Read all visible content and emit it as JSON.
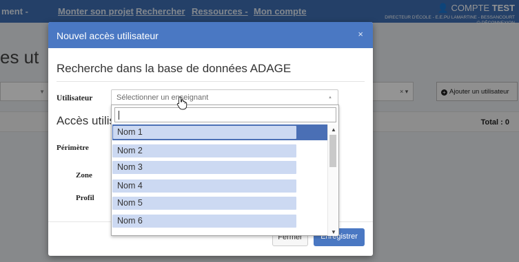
{
  "background": {
    "nav": {
      "items": [
        "ment -",
        "Monter son projet",
        "Rechercher",
        "Ressources -",
        "Mon compte"
      ]
    },
    "account": {
      "name_prefix": "COMPTE",
      "name_bold": "TEST",
      "role": "DIRECTEUR D'ÉCOLE - E.E.PU LAMARTINE - BESSANCOURT",
      "logout": "DÉCONNEXION"
    },
    "page_title": "es ut",
    "filter_clear": "× ▾",
    "add_user_label": "Ajouter un utilisateur",
    "total_label": "Total : 0"
  },
  "modal": {
    "title": "Nouvel accès utilisateur",
    "close": "×",
    "section_title": "Recherche dans la base de données ADAGE",
    "user_label": "Utilisateur",
    "select_placeholder": "Sélectionner un enseignant",
    "section2_title": "Accès utilis",
    "perimetre_label": "Périmètre",
    "zone_label": "Zone",
    "profil_label": "Profil",
    "cancel_label": "Fermer",
    "save_label": "Enregistrer"
  },
  "dropdown": {
    "search_value": "",
    "options": [
      "Nom 1",
      "Nom 2",
      "Nom 3",
      "Nom 4",
      "Nom 5",
      "Nom 6"
    ],
    "highlighted_index": 0
  },
  "colors": {
    "primary": "#4a78c3",
    "highlight": "#4a6fb5",
    "option_fill": "#ccd9f2"
  }
}
